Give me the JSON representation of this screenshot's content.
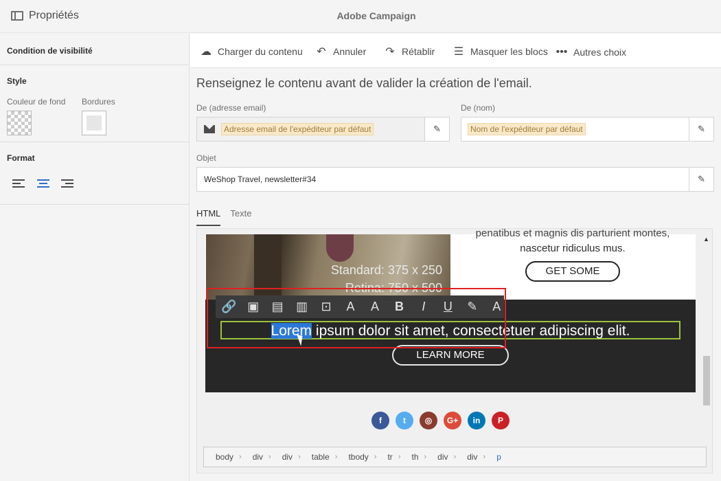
{
  "header": {
    "panel_title": "Propriétés",
    "app_title": "Adobe Campaign"
  },
  "left_panel": {
    "visibility_title": "Condition de visibilité",
    "style_title": "Style",
    "bg_color_label": "Couleur de fond",
    "borders_label": "Bordures",
    "format_title": "Format"
  },
  "toolbar": {
    "upload": "Charger du contenu",
    "undo": "Annuler",
    "redo": "Rétablir",
    "hide_blocks": "Masquer les blocs",
    "more": "Autres choix"
  },
  "form": {
    "instruction": "Renseignez le contenu avant de valider la création de l'email.",
    "from_email_label": "De (adresse email)",
    "from_email_chip": "Adresse email de l'expéditeur par défaut",
    "from_name_label": "De (nom)",
    "from_name_chip": "Nom de l'expéditeur par défaut",
    "subject_label": "Objet",
    "subject_value": "WeShop Travel, newsletter#34"
  },
  "tabs": [
    "HTML",
    "Texte"
  ],
  "preview": {
    "image_dims_standard": "Standard: 375 x 250",
    "image_dims_retina": "Retina: 750 x 500",
    "right_text_clip": "penatibus et magnis dis parturient montes,",
    "right_text": "nascetur ridiculus mus.",
    "get_some": "GET SOME",
    "selected_word": "Lorem",
    "body_text": " ipsum dolor sit amet, consectetuer adipiscing elit.",
    "learn_more": "LEARN MORE"
  },
  "rte_tools": [
    "link-icon",
    "image-icon",
    "block-icon",
    "columns-icon",
    "personalize-icon",
    "font-icon",
    "font-size-icon",
    "bold-icon",
    "italic-icon",
    "underline-icon",
    "color-picker-icon",
    "clear-format-icon"
  ],
  "socials": [
    {
      "name": "facebook",
      "label": "f",
      "color": "#3b5998"
    },
    {
      "name": "twitter",
      "label": "t",
      "color": "#55acee"
    },
    {
      "name": "instagram",
      "label": "◎",
      "color": "#8a3b2e"
    },
    {
      "name": "google-plus",
      "label": "G+",
      "color": "#dd4b39"
    },
    {
      "name": "linkedin",
      "label": "in",
      "color": "#0077b5"
    },
    {
      "name": "pinterest",
      "label": "P",
      "color": "#cb2027"
    }
  ],
  "breadcrumb": [
    "body",
    "div",
    "div",
    "table",
    "tbody",
    "tr",
    "th",
    "div",
    "div",
    "p"
  ]
}
